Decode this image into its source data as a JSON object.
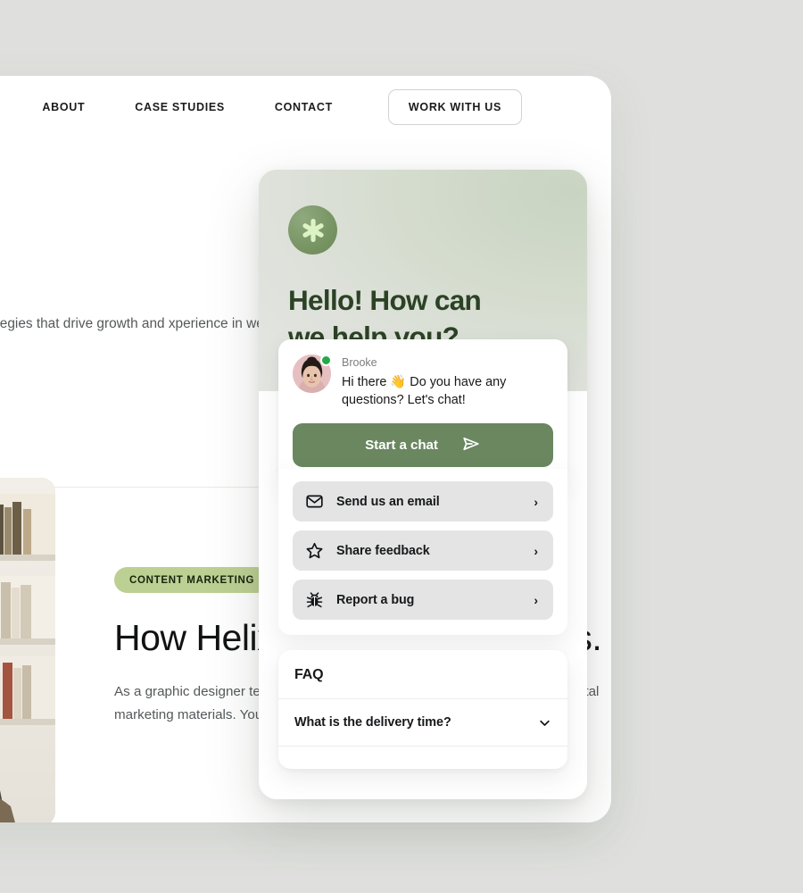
{
  "page": {
    "background_color": "#dfe0dd",
    "nav": {
      "links": [
        {
          "label": "ABOUT"
        },
        {
          "label": "CASE STUDIES"
        },
        {
          "label": "CONTACT"
        }
      ],
      "cta_label": "WORK WITH US"
    },
    "hero": {
      "paragraph": "marketing strategies that drive growth and xperience in web design, search engine optim e."
    },
    "article": {
      "badge": "CONTENT MARKETING",
      "heading": "How Helix Following b Months.",
      "body": "As a graphic designer te critical in creating visually appealing and effective digital marketing materials. Your expertise in design software, typography,"
    },
    "photo_alt": "person-reading-in-library"
  },
  "chat_widget": {
    "header": {
      "brand_icon": "asterisk-sparkle-icon",
      "title": "Hello! How can we help you?",
      "title_color": "#2c4225",
      "gradient_from": "#c9d4c2",
      "gradient_to": "#e4e6e1"
    },
    "intro": {
      "agent_name": "Brooke",
      "agent_status": "online",
      "message": "Hi there 👋 Do you have any questions? Let's chat!",
      "start_chat_label": "Start a chat",
      "start_chat_color": "#6a8760",
      "send_icon": "paper-plane-icon"
    },
    "actions": [
      {
        "label": "Send us an email",
        "icon": "envelope-icon",
        "chevron": "›"
      },
      {
        "label": "Share feedback",
        "icon": "star-icon",
        "chevron": "›"
      },
      {
        "label": "Report a bug",
        "icon": "bug-icon",
        "chevron": "›"
      }
    ],
    "faq": {
      "title": "FAQ",
      "items": [
        {
          "question": "What is the delivery time?",
          "chevron": "chevron-down-icon"
        }
      ]
    }
  }
}
